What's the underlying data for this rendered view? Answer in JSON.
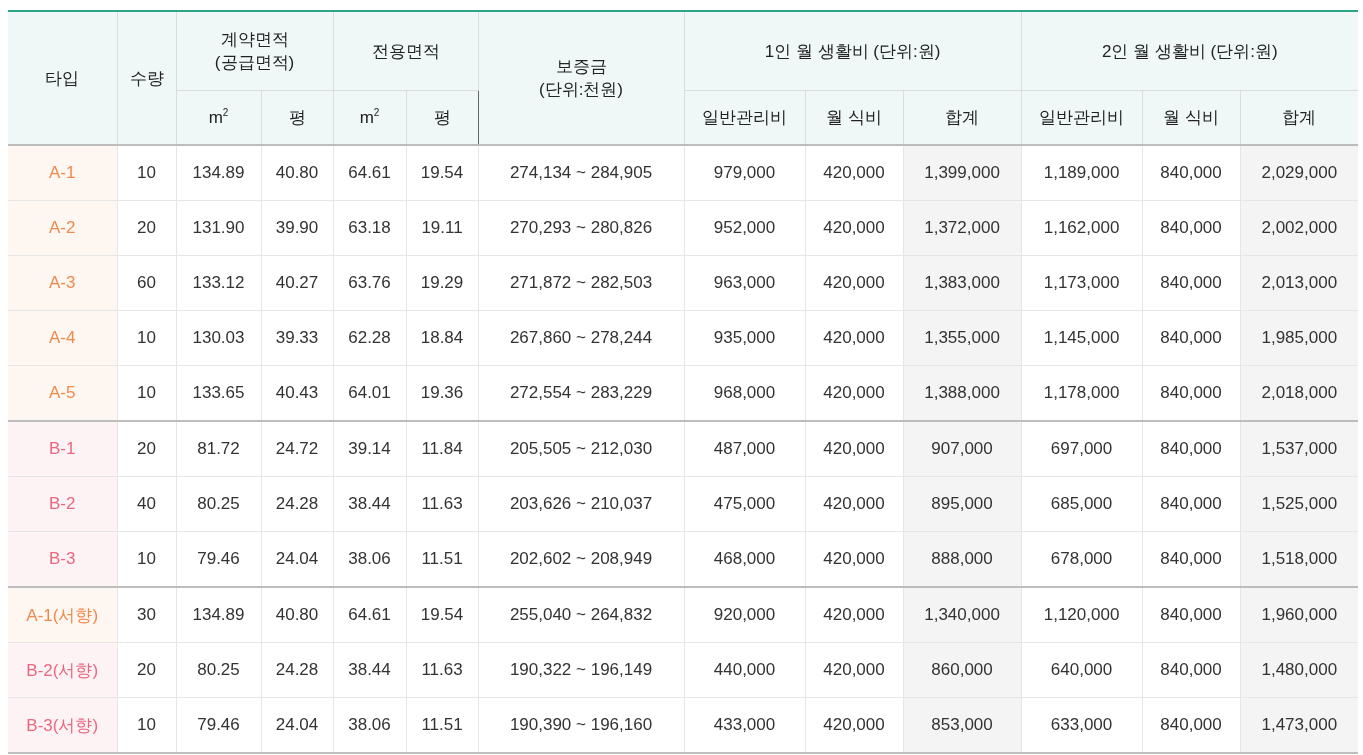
{
  "table": {
    "columns": [
      {
        "label": "타입",
        "kind": "type"
      },
      {
        "label": "수량",
        "kind": "value"
      },
      {
        "label": "계약면적\n(공급면적)",
        "children": [
          {
            "label": "m$^{2}$",
            "kind": "value"
          },
          {
            "label": "평",
            "kind": "value"
          }
        ]
      },
      {
        "label": "전용면적",
        "children": [
          {
            "label": "m$^{2}$",
            "kind": "value"
          },
          {
            "label": "평",
            "kind": "value"
          }
        ]
      },
      {
        "label": "보증금\n(단위:천원)",
        "kind": "value"
      },
      {
        "label": "1인 월 생활비 (단위:원)",
        "children": [
          {
            "label": "일반관리비",
            "kind": "value"
          },
          {
            "label": "월 식비",
            "kind": "value"
          },
          {
            "label": "합계",
            "kind": "total"
          }
        ]
      },
      {
        "label": "2인 월 생활비 (단위:원)",
        "children": [
          {
            "label": "일반관리비",
            "kind": "value"
          },
          {
            "label": "월 식비",
            "kind": "value"
          },
          {
            "label": "합계",
            "kind": "total"
          }
        ]
      }
    ],
    "groups": [
      {
        "rows": [
          {
            "color": "#f08a4b",
            "cells": [
              "A-1",
              "10",
              "134.89",
              "40.80",
              "64.61",
              "19.54",
              "274,134 ~ 284,905",
              "979,000",
              "420,000",
              "1,399,000",
              "1,189,000",
              "840,000",
              "2,029,000"
            ]
          },
          {
            "color": "#f08a4b",
            "cells": [
              "A-2",
              "20",
              "131.90",
              "39.90",
              "63.18",
              "19.11",
              "270,293 ~ 280,826",
              "952,000",
              "420,000",
              "1,372,000",
              "1,162,000",
              "840,000",
              "2,002,000"
            ]
          },
          {
            "color": "#f08a4b",
            "cells": [
              "A-3",
              "60",
              "133.12",
              "40.27",
              "63.76",
              "19.29",
              "271,872 ~ 282,503",
              "963,000",
              "420,000",
              "1,383,000",
              "1,173,000",
              "840,000",
              "2,013,000"
            ]
          },
          {
            "color": "#f08a4b",
            "cells": [
              "A-4",
              "10",
              "130.03",
              "39.33",
              "62.28",
              "18.84",
              "267,860 ~ 278,244",
              "935,000",
              "420,000",
              "1,355,000",
              "1,145,000",
              "840,000",
              "1,985,000"
            ]
          },
          {
            "color": "#f08a4b",
            "cells": [
              "A-5",
              "10",
              "133.65",
              "40.43",
              "64.01",
              "19.36",
              "272,554 ~ 283,229",
              "968,000",
              "420,000",
              "1,388,000",
              "1,178,000",
              "840,000",
              "2,018,000"
            ]
          }
        ]
      },
      {
        "rows": [
          {
            "color": "#e9687f",
            "cells": [
              "B-1",
              "20",
              "81.72",
              "24.72",
              "39.14",
              "11.84",
              "205,505 ~ 212,030",
              "487,000",
              "420,000",
              "907,000",
              "697,000",
              "840,000",
              "1,537,000"
            ]
          },
          {
            "color": "#e9687f",
            "cells": [
              "B-2",
              "40",
              "80.25",
              "24.28",
              "38.44",
              "11.63",
              "203,626 ~ 210,037",
              "475,000",
              "420,000",
              "895,000",
              "685,000",
              "840,000",
              "1,525,000"
            ]
          },
          {
            "color": "#e9687f",
            "cells": [
              "B-3",
              "10",
              "79.46",
              "24.04",
              "38.06",
              "11.51",
              "202,602 ~ 208,949",
              "468,000",
              "420,000",
              "888,000",
              "678,000",
              "840,000",
              "1,518,000"
            ]
          }
        ]
      },
      {
        "rows": [
          {
            "color": "#f08a4b",
            "cells": [
              "A-1(서향)",
              "30",
              "134.89",
              "40.80",
              "64.61",
              "19.54",
              "255,040 ~ 264,832",
              "920,000",
              "420,000",
              "1,340,000",
              "1,120,000",
              "840,000",
              "1,960,000"
            ]
          },
          {
            "color": "#e9687f",
            "cells": [
              "B-2(서향)",
              "20",
              "80.25",
              "24.28",
              "38.44",
              "11.63",
              "190,322 ~ 196,149",
              "440,000",
              "420,000",
              "860,000",
              "640,000",
              "840,000",
              "1,480,000"
            ]
          },
          {
            "color": "#e9687f",
            "cells": [
              "B-3(서향)",
              "10",
              "79.46",
              "24.04",
              "38.06",
              "11.51",
              "190,390 ~ 196,160",
              "433,000",
              "420,000",
              "853,000",
              "633,000",
              "840,000",
              "1,473,000"
            ]
          }
        ]
      }
    ]
  }
}
